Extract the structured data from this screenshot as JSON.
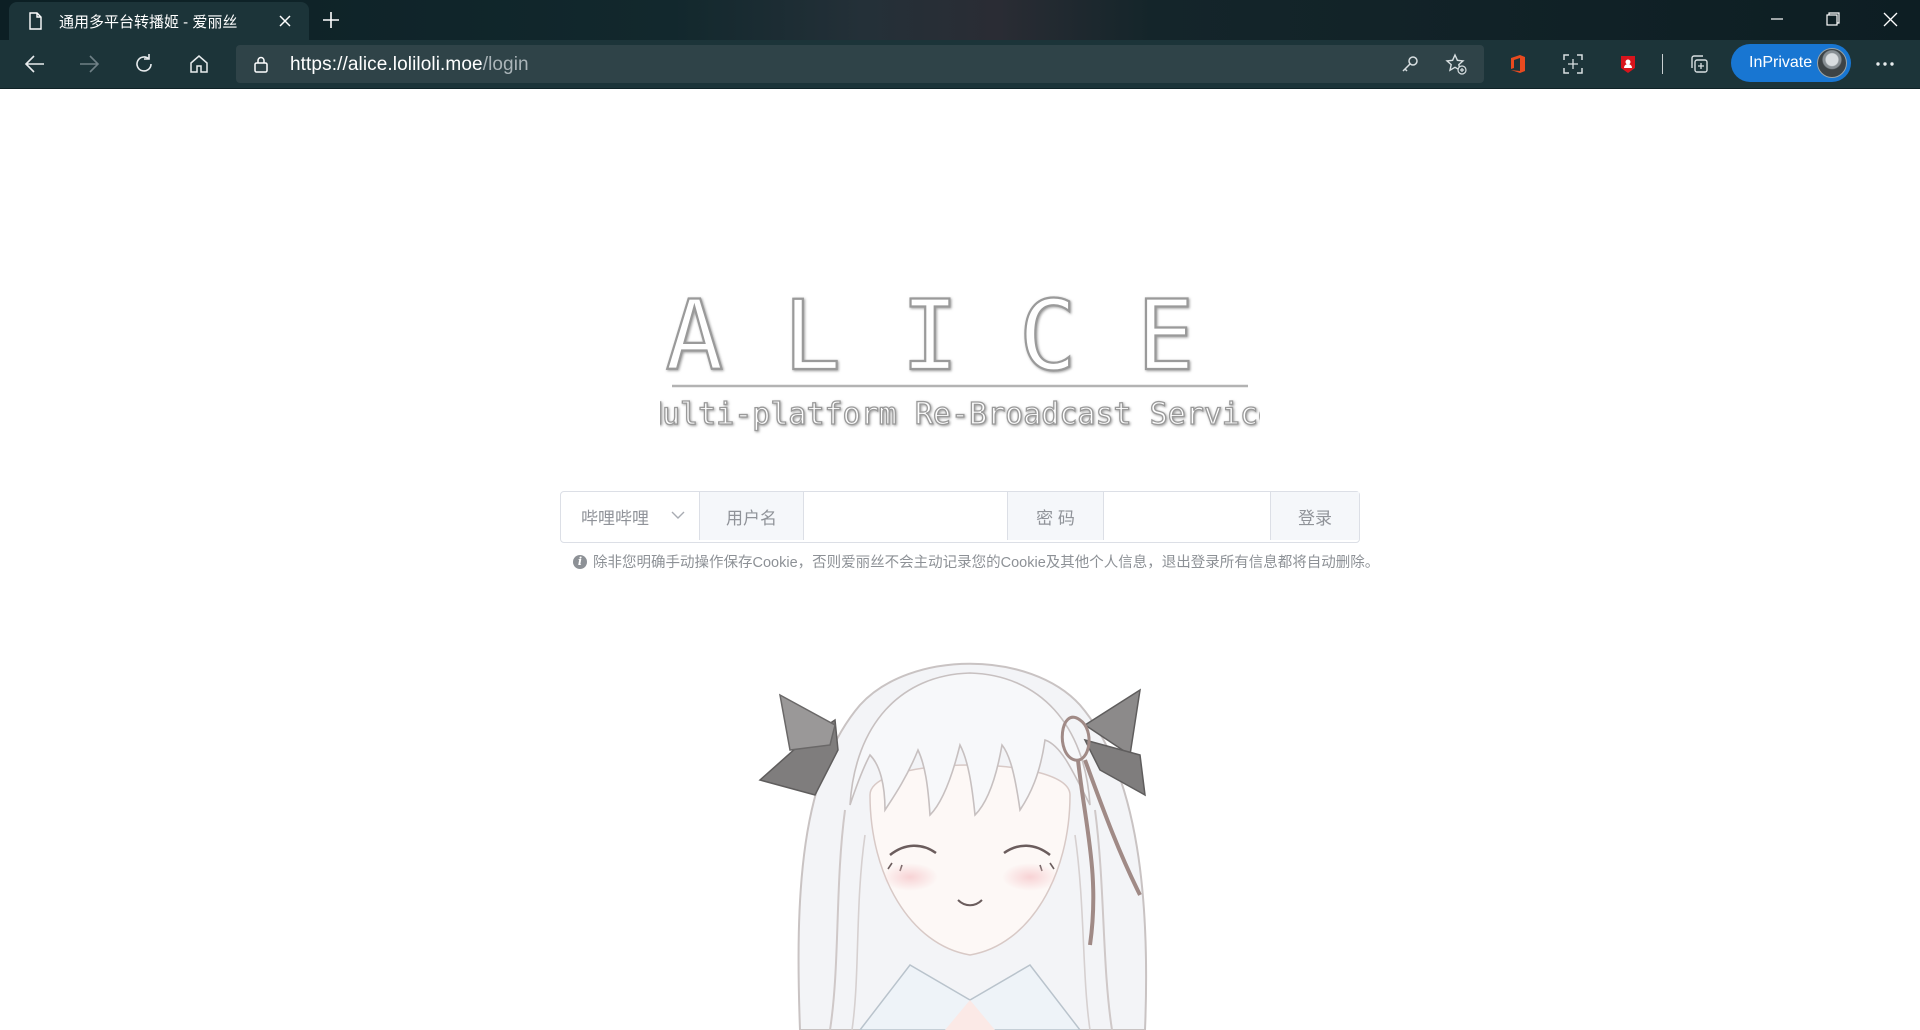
{
  "browser": {
    "tab_title": "通用多平台转播姬 - 爱丽丝",
    "url_scheme": "https://",
    "url_host": "alice.lolilolі.moe",
    "url_path": "/login",
    "inprivate_label": "InPrivate"
  },
  "page": {
    "logo_title": "ALICE",
    "logo_subtitle": "Multi-platform Re-Broadcast Service",
    "platform_select": "哔哩哔哩",
    "username_label": "用户名",
    "username_value": "",
    "password_label": "密 码",
    "password_value": "",
    "login_button": "登录",
    "notice": "除非您明确手动操作保存Cookie，否则爱丽丝不会主动记录您的Cookie及其他个人信息，退出登录所有信息都将自动删除。",
    "notice_icon": "i"
  },
  "colors": {
    "chrome_bg": "#1c3439",
    "accent": "#1876d2",
    "border": "#dcdfe6",
    "muted_text": "#909399"
  }
}
